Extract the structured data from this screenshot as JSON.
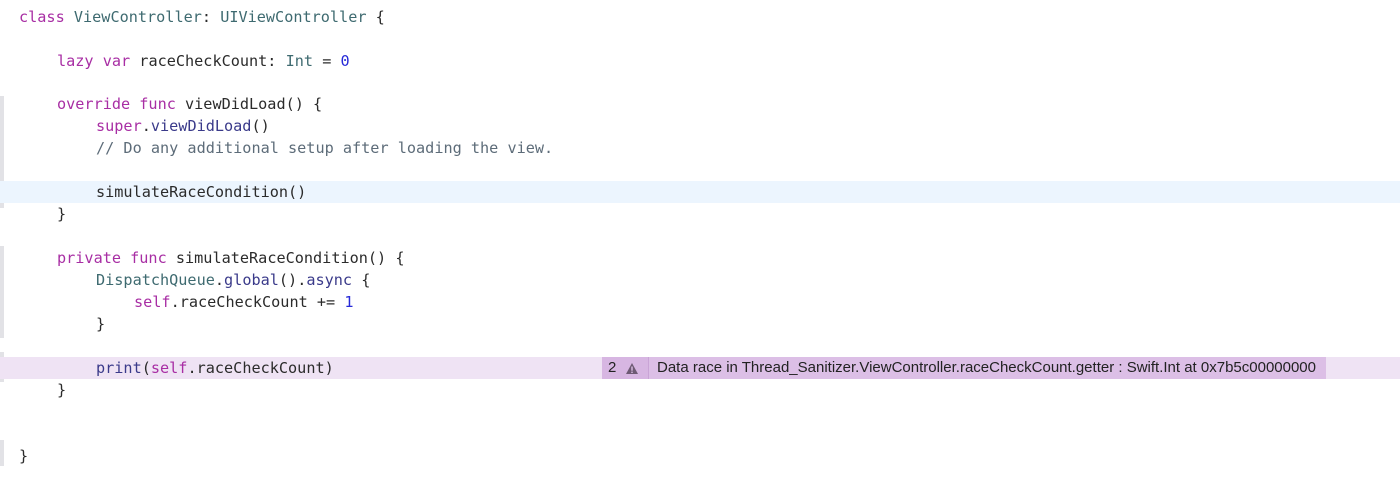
{
  "code_lines": [
    {
      "id": "l1",
      "text": "class ViewController: UIViewController {"
    },
    {
      "id": "l2",
      "text": "lazy var raceCheckCount: Int = 0"
    },
    {
      "id": "l3",
      "text": "override func viewDidLoad() {"
    },
    {
      "id": "l4",
      "text": "super.viewDidLoad()"
    },
    {
      "id": "l5",
      "text": "// Do any additional setup after loading the view."
    },
    {
      "id": "l6",
      "text": "simulateRaceCondition()"
    },
    {
      "id": "l7",
      "text": "}"
    },
    {
      "id": "l8",
      "text": "private func simulateRaceCondition() {"
    },
    {
      "id": "l9",
      "text": "DispatchQueue.global().async {"
    },
    {
      "id": "l10",
      "text": "self.raceCheckCount += 1"
    },
    {
      "id": "l11",
      "text": "}"
    },
    {
      "id": "l12",
      "text": "print(self.raceCheckCount)"
    },
    {
      "id": "l13",
      "text": "}"
    },
    {
      "id": "l14",
      "text": "}"
    }
  ],
  "issue": {
    "count": "2",
    "icon": "warning-triangle-icon",
    "message": "Data race in Thread_Sanitizer.ViewController.raceCheckCount.getter : Swift.Int at 0x7b5c00000000",
    "color": "#dcbfe6"
  },
  "colors": {
    "current_line": "#ecf5fe",
    "race_line": "#efe3f4",
    "keyword": "#a82ea4",
    "comment": "#5d6c79"
  }
}
